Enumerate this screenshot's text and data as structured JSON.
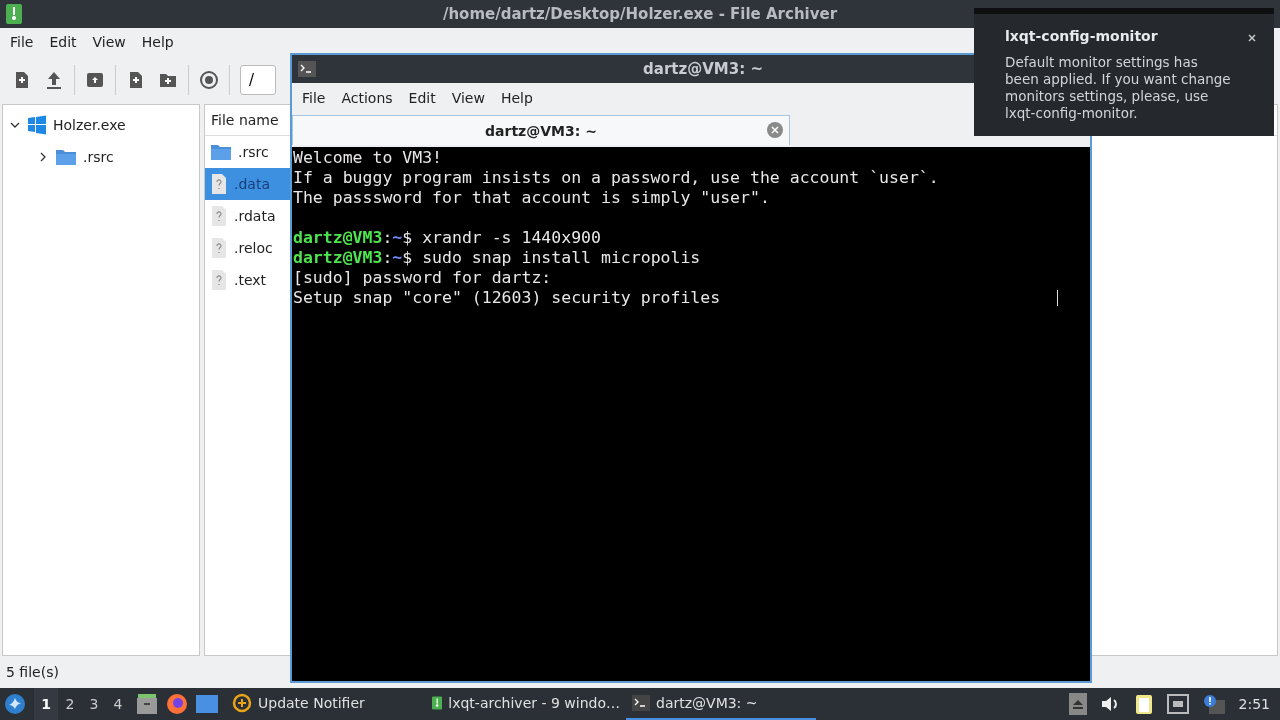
{
  "archiver": {
    "title": "/home/dartz/Desktop/Holzer.exe - File Archiver",
    "menu": [
      "File",
      "Edit",
      "View",
      "Help"
    ],
    "path": "/",
    "tree": [
      {
        "label": "Holzer.exe",
        "kind": "exe",
        "expanded": true,
        "children": [
          {
            "label": ".rsrc",
            "kind": "folder",
            "expanded": false
          }
        ]
      }
    ],
    "column": "File name",
    "files": [
      {
        "name": ".rsrc",
        "kind": "folder",
        "selected": false
      },
      {
        "name": ".data",
        "kind": "unknown",
        "selected": true
      },
      {
        "name": ".rdata",
        "kind": "unknown",
        "selected": false
      },
      {
        "name": ".reloc",
        "kind": "unknown",
        "selected": false
      },
      {
        "name": ".text",
        "kind": "unknown",
        "selected": false
      }
    ],
    "status_bar": "5 file(s)"
  },
  "terminal": {
    "title": "dartz@VM3: ~",
    "menu": [
      "File",
      "Actions",
      "Edit",
      "View",
      "Help"
    ],
    "tabs": [
      {
        "label": "dartz@VM3: ~",
        "selected": true
      }
    ],
    "lines": [
      {
        "kind": "text",
        "text": "Welcome to VM3!"
      },
      {
        "kind": "text",
        "text": "If a buggy program insists on a password, use the account `user`."
      },
      {
        "kind": "text",
        "text": "The passsword for that account is simply \"user\"."
      },
      {
        "kind": "blank"
      },
      {
        "kind": "prompt",
        "user": "dartz@VM3",
        "sep": ":",
        "path": "~",
        "command": "$ xrandr -s 1440x900"
      },
      {
        "kind": "prompt",
        "user": "dartz@VM3",
        "sep": ":",
        "path": "~",
        "command": "$ sudo snap install micropolis"
      },
      {
        "kind": "text",
        "text": "[sudo] password for dartz:"
      },
      {
        "kind": "text",
        "text": "Setup snap \"core\" (12603) security profiles"
      }
    ]
  },
  "notification": {
    "title": "lxqt-config-monitor",
    "body": "Default monitor settings has been applied. If you want change monitors settings, please, use lxqt-config-monitor."
  },
  "taskbar": {
    "desktops": [
      {
        "label": "1",
        "selected": true
      },
      {
        "label": "2",
        "selected": false
      },
      {
        "label": "3",
        "selected": false
      },
      {
        "label": "4",
        "selected": false
      }
    ],
    "tasks": [
      {
        "label": "Update Notifier",
        "kind": "notifier",
        "selected": false
      },
      {
        "label": "lxqt-archiver - 9 windo…",
        "kind": "archiver",
        "selected": false
      },
      {
        "label": "dartz@VM3: ~",
        "kind": "terminal",
        "selected": true
      }
    ],
    "clock": "2:51"
  }
}
